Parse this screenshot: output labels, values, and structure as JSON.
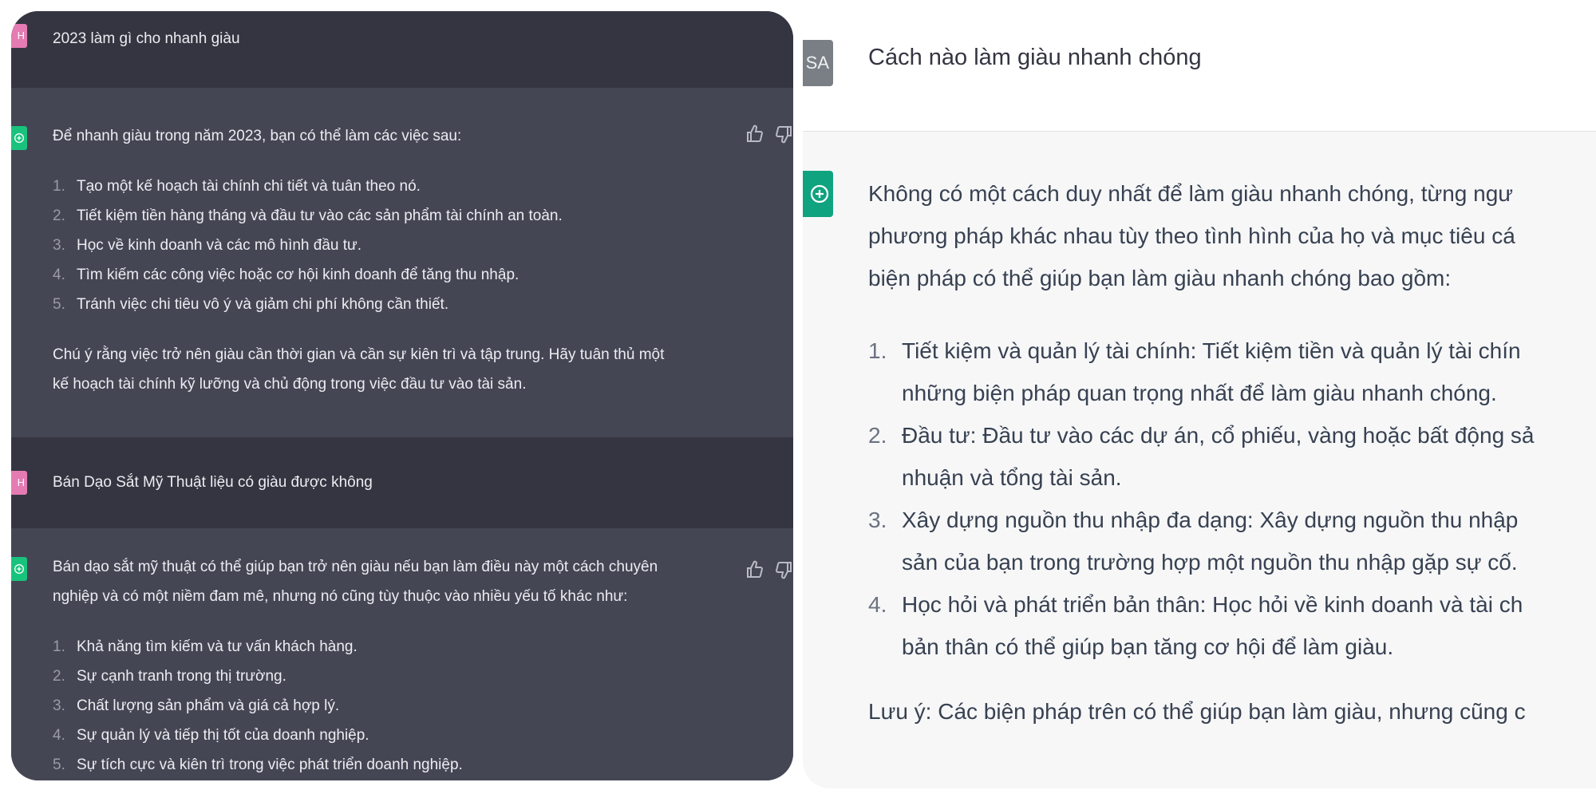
{
  "left": {
    "q1": "2023 làm gì cho nhanh giàu",
    "a1": {
      "intro": "Để nhanh giàu trong năm 2023, bạn có thể làm các việc sau:",
      "items": [
        "Tạo một kế hoạch tài chính chi tiết và tuân theo nó.",
        "Tiết kiệm tiền hàng tháng và đầu tư vào các sản phẩm tài chính an toàn.",
        "Học về kinh doanh và các mô hình đầu tư.",
        "Tìm kiếm các công việc hoặc cơ hội kinh doanh để tăng thu nhập.",
        "Tránh việc chi tiêu vô ý và giảm chi phí không cần thiết."
      ],
      "note_line1": "Chú ý rằng việc trở nên giàu cần thời gian và cần sự kiên trì và tập trung. Hãy tuân thủ một",
      "note_line2": "kế hoạch tài chính kỹ lưỡng và chủ động trong việc đầu tư vào tài sản."
    },
    "q2": "Bán Dạo Sắt Mỹ Thuật liệu có giàu được không",
    "a2": {
      "intro_line1": "Bán dạo sắt mỹ thuật có thể giúp bạn trở nên giàu nếu bạn làm điều này một cách chuyên",
      "intro_line2": "nghiệp và có một niềm đam mê, nhưng nó cũng tùy thuộc vào nhiều yếu tố khác như:",
      "items": [
        "Khả năng tìm kiếm và tư vấn khách hàng.",
        "Sự cạnh tranh trong thị trường.",
        "Chất lượng sản phẩm và giá cả hợp lý.",
        "Sự quản lý và tiếp thị tốt của doanh nghiệp.",
        "Sự tích cực và kiên trì trong việc phát triển doanh nghiệp."
      ]
    },
    "avatar_user_letter": "H"
  },
  "right": {
    "avatar_user_letter": "SA",
    "question": "Cách nào làm giàu nhanh chóng",
    "intro_lines": [
      "Không có một cách duy nhất để làm giàu nhanh chóng, từng ngư",
      "phương pháp khác nhau tùy theo tình hình của họ và mục tiêu cá",
      "biện pháp có thể giúp bạn làm giàu nhanh chóng bao gồm:"
    ],
    "items": [
      {
        "line1": "Tiết kiệm và quản lý tài chính: Tiết kiệm tiền và quản lý tài chín",
        "line2": "những biện pháp quan trọng nhất để làm giàu nhanh chóng."
      },
      {
        "line1": "Đầu tư: Đầu tư vào các dự án, cổ phiếu, vàng hoặc bất động sả",
        "line2": "nhuận và tổng tài sản."
      },
      {
        "line1": "Xây dựng nguồn thu nhập đa dạng: Xây dựng nguồn thu nhập",
        "line2": "sản của bạn trong trường hợp một nguồn thu nhập gặp sự cố."
      },
      {
        "line1": "Học hỏi và phát triển bản thân: Học hỏi về kinh doanh và tài ch",
        "line2": "bản thân có thể giúp bạn tăng cơ hội để làm giàu."
      }
    ],
    "note": "Lưu ý: Các biện pháp trên có thể giúp bạn làm giàu, nhưng cũng c"
  },
  "colors": {
    "left_user_bg": "#343541",
    "left_ai_bg": "#444654",
    "right_bg": "#f7f7f8",
    "ai_green": "#10a37f",
    "user_pink": "#e57bb3"
  }
}
